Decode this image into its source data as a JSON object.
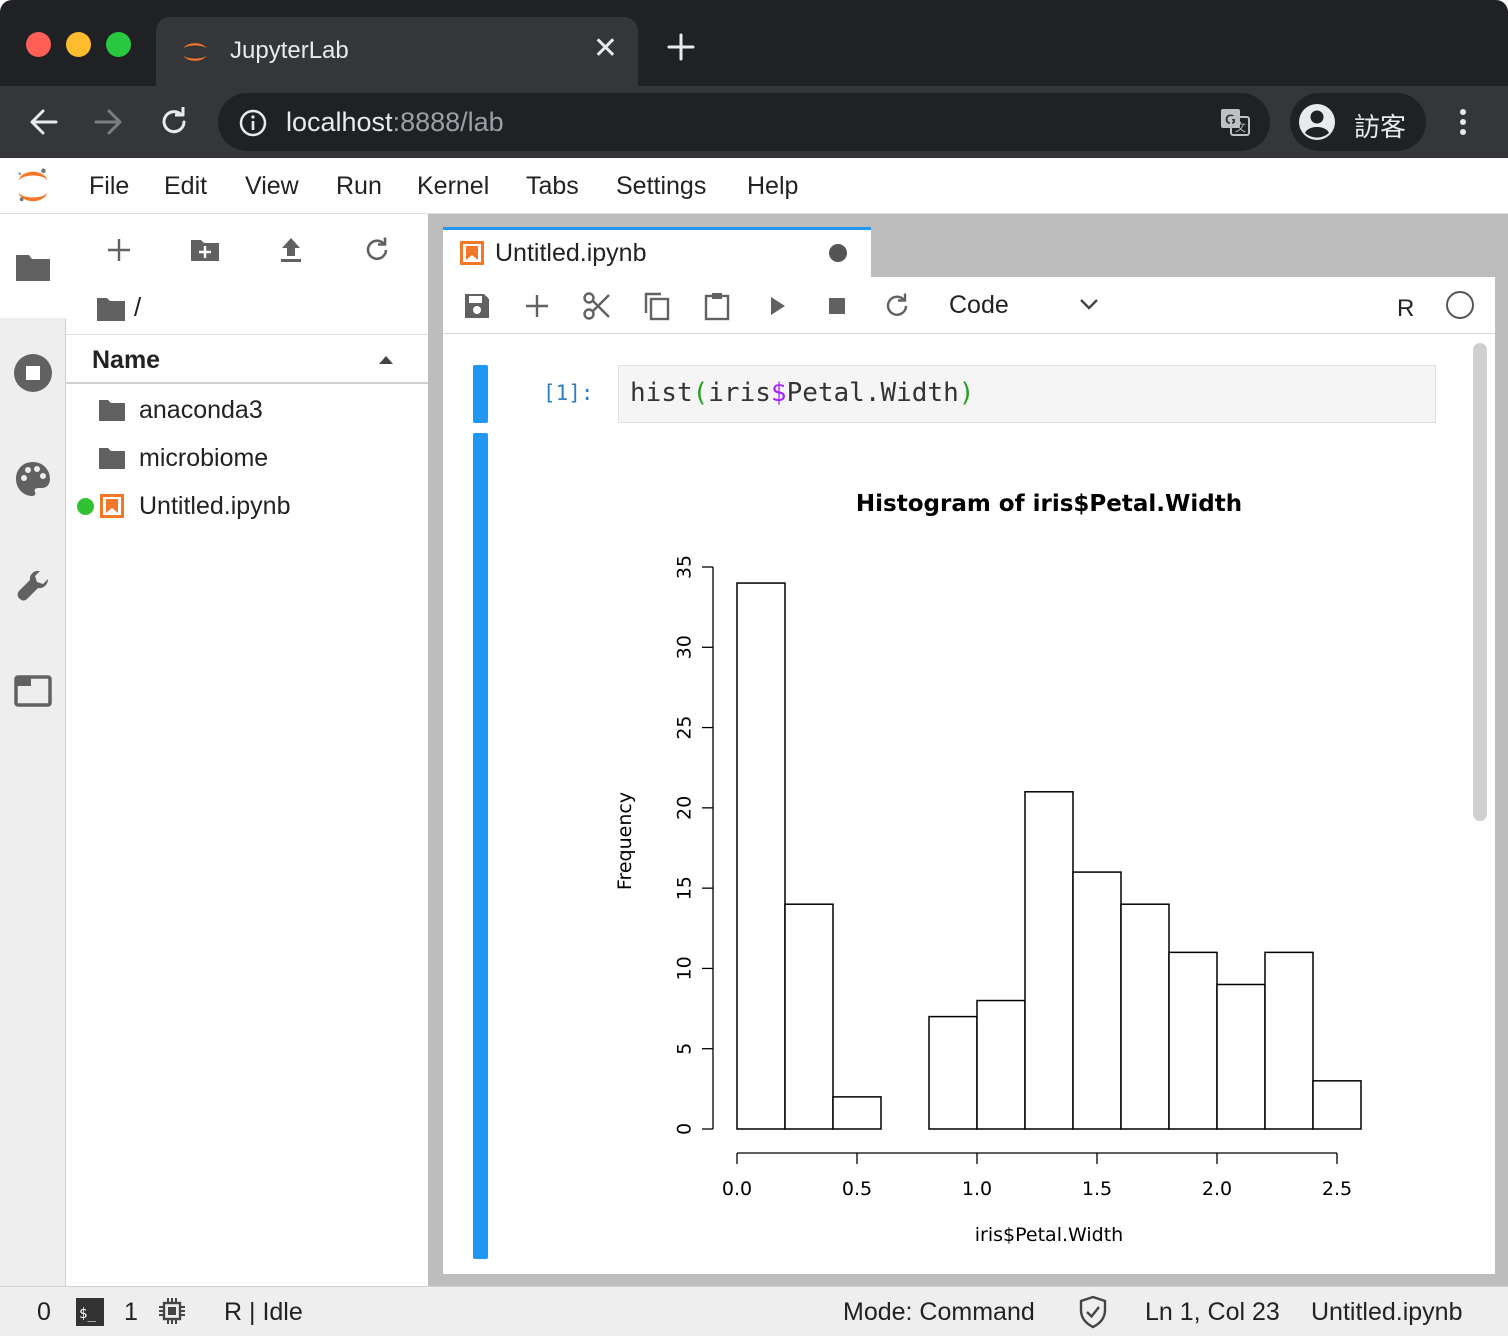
{
  "browser": {
    "tab_title": "JupyterLab",
    "tab_close": "✕",
    "url_host": "localhost",
    "url_rest": ":8888/lab",
    "profile_name": "訪客"
  },
  "menu": {
    "items": [
      "File",
      "Edit",
      "View",
      "Run",
      "Kernel",
      "Tabs",
      "Settings",
      "Help"
    ]
  },
  "filebrowser": {
    "path": "/",
    "column_header": "Name",
    "items": [
      {
        "name": "anaconda3",
        "type": "folder",
        "running": false
      },
      {
        "name": "microbiome",
        "type": "folder",
        "running": false
      },
      {
        "name": "Untitled.ipynb",
        "type": "notebook",
        "running": true
      }
    ]
  },
  "notebook": {
    "tab_label": "Untitled.ipynb",
    "cell_type": "Code",
    "kernel_name": "R",
    "cell": {
      "prompt": "[1]:",
      "code_tokens": [
        {
          "text": "hist",
          "cls": ""
        },
        {
          "text": "(",
          "cls": "tok-paren"
        },
        {
          "text": "iris",
          "cls": ""
        },
        {
          "text": "$",
          "cls": "tok-op"
        },
        {
          "text": "Petal.Width",
          "cls": ""
        },
        {
          "text": ")",
          "cls": "tok-paren"
        }
      ]
    }
  },
  "chart_data": {
    "type": "bar",
    "title": "Histogram of iris$Petal.Width",
    "xlabel": "iris$Petal.Width",
    "ylabel": "Frequency",
    "bins": [
      [
        0.0,
        0.2
      ],
      [
        0.2,
        0.4
      ],
      [
        0.4,
        0.6
      ],
      [
        0.6,
        0.8
      ],
      [
        0.8,
        1.0
      ],
      [
        1.0,
        1.2
      ],
      [
        1.2,
        1.4
      ],
      [
        1.4,
        1.6
      ],
      [
        1.6,
        1.8
      ],
      [
        1.8,
        2.0
      ],
      [
        2.0,
        2.2
      ],
      [
        2.2,
        2.4
      ],
      [
        2.4,
        2.6
      ]
    ],
    "values": [
      34,
      14,
      2,
      0,
      7,
      8,
      21,
      16,
      14,
      11,
      9,
      11,
      3
    ],
    "xlim": [
      0.0,
      2.6
    ],
    "ylim": [
      0,
      35
    ],
    "x_ticks": [
      "0.0",
      "0.5",
      "1.0",
      "1.5",
      "2.0",
      "2.5"
    ],
    "y_ticks": [
      "0",
      "5",
      "10",
      "15",
      "20",
      "25",
      "30",
      "35"
    ],
    "grid": false,
    "bar_fill": "#ffffff",
    "bar_stroke": "#000000"
  },
  "statusbar": {
    "terminals": "0",
    "kernels": "1",
    "kernel_state": "R | Idle",
    "mode": "Mode: Command",
    "position": "Ln 1, Col 23",
    "filename": "Untitled.ipynb"
  },
  "colors": {
    "accent": "#2196f3",
    "jupyter_orange": "#f37726",
    "running_green": "#32c132"
  }
}
